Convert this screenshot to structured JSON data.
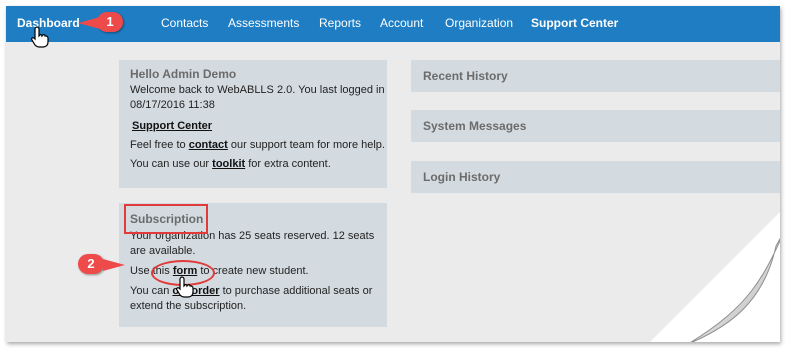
{
  "nav": {
    "dashboard": "Dashboard",
    "contacts": "Contacts",
    "assessments": "Assessments",
    "reports": "Reports",
    "account": "Account",
    "organization": "Organization",
    "support_center": "Support Center"
  },
  "welcome": {
    "title": "Hello Admin Demo",
    "line1": "Welcome back to WebABLLS 2.0. You last logged in",
    "line2": "08/17/2016 11:38",
    "support_link": "Support Center",
    "contact_prefix": "Feel free to",
    "contact_link": "contact",
    "contact_suffix": "our support team for more help.",
    "toolkit_prefix": "You can use our",
    "toolkit_link": "toolkit",
    "toolkit_suffix": "for extra content."
  },
  "subscription": {
    "title": "Subscription",
    "seats_line1": "Your organization has 25 seats reserved. 12 seats",
    "seats_line2": "are available.",
    "form_prefix": "Use this",
    "form_link": "form",
    "form_suffix": "to create new student.",
    "order_prefix": "You can",
    "order_link": "order",
    "order_link_hidden": "o",
    "order_suffix": "to purchase additional seats or",
    "order_line2": "extend the subscription."
  },
  "panels": {
    "recent_history": "Recent History",
    "system_messages": "System Messages",
    "login_history": "Login History"
  },
  "callouts": {
    "one": "1",
    "two": "2"
  },
  "colors": {
    "navbar": "#1f7dc4",
    "card": "#d4dbe0",
    "callout": "#ee4a4a",
    "page_bg": "#ebebeb"
  }
}
